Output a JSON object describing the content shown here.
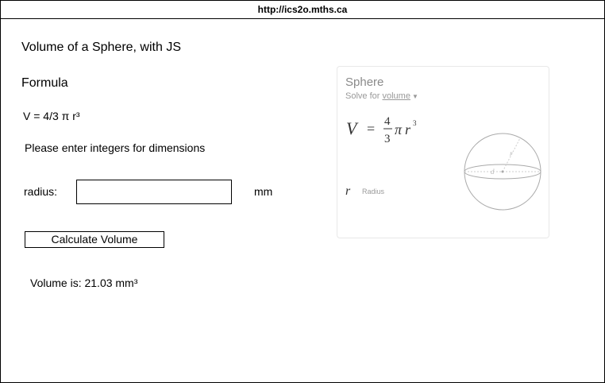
{
  "browser": {
    "url": "http://ics2o.mths.ca"
  },
  "page": {
    "title": "Volume of a Sphere, with JS",
    "formula_heading": "Formula",
    "formula_text": "V = 4/3 π r³",
    "instruction": "Please enter integers for dimensions",
    "radius_label": "radius:",
    "radius_value": "",
    "unit_label": "mm",
    "calculate_button": "Calculate Volume",
    "result_text": "Volume is: 21.03 mm³"
  },
  "card": {
    "title": "Sphere",
    "solve_for_prefix": "Solve for",
    "solve_for_value": "volume",
    "formula": {
      "lhs": "V",
      "equals": "=",
      "numerator": "4",
      "denominator": "3",
      "pi": "π",
      "var": "r",
      "exponent": "3"
    },
    "variable_symbol": "r",
    "variable_description": "Radius",
    "diagram": {
      "radius_label": "r",
      "diameter_label": "d"
    }
  },
  "colors": {
    "card_title": "#8a8a8a",
    "card_muted": "#999999",
    "border": "#000000"
  }
}
